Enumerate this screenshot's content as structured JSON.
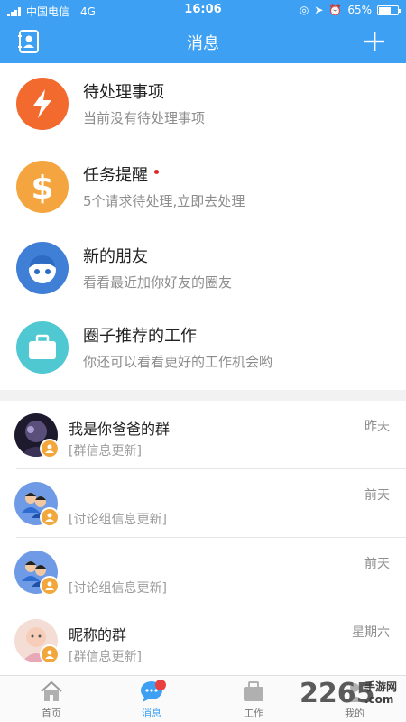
{
  "status": {
    "carrier": "中国电信",
    "network": "4G",
    "time": "16:06",
    "battery": "65%",
    "battery_level": 0.65
  },
  "header": {
    "title": "消息",
    "add_icon": "plus-icon",
    "contacts_icon": "contacts-book-icon",
    "bg_color": "#3da0f2"
  },
  "features": [
    {
      "title": "待处理事项",
      "subtitle": "当前没有待处理事项",
      "icon": "lightning-icon",
      "color": "#f26a2e"
    },
    {
      "title": "任务提醒",
      "subtitle": "5个请求待处理,立即去处理",
      "icon": "dollar-icon",
      "color": "#f5a540",
      "unread_dot": true
    },
    {
      "title": "新的朋友",
      "subtitle": "看看最近加你好友的圈友",
      "icon": "face-icon",
      "color": "#3f7fd6"
    },
    {
      "title": "圈子推荐的工作",
      "subtitle": "你还可以看看更好的工作机会哟",
      "icon": "briefcase-icon",
      "color": "#4fc8d2"
    }
  ],
  "chats": [
    {
      "name": "我是你爸爸的群",
      "time": "昨天",
      "message": "[群信息更新]",
      "avatar": "group-photo-avatar"
    },
    {
      "name": "",
      "time": "前天",
      "message": "[讨论组信息更新]",
      "avatar": "people-avatar"
    },
    {
      "name": "",
      "time": "前天",
      "message": "[讨论组信息更新]",
      "avatar": "people-avatar"
    },
    {
      "name": "昵称的群",
      "time": "星期六",
      "message": "[群信息更新]",
      "avatar": "baby-photo-avatar"
    }
  ],
  "tabs": [
    {
      "label": "首页",
      "icon": "home-icon"
    },
    {
      "label": "消息",
      "icon": "chat-bubble-icon",
      "active": true,
      "has_badge": true
    },
    {
      "label": "工作",
      "icon": "briefcase-icon"
    },
    {
      "label": "我的",
      "icon": "person-icon"
    }
  ],
  "watermark": {
    "text": "2265",
    "suffix": "手游网",
    "suffix2": ".com"
  }
}
